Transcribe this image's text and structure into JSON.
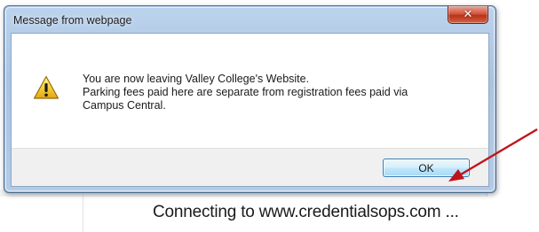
{
  "dialog": {
    "title": "Message from webpage",
    "close_icon": "close-icon",
    "warning_icon": "warning-icon",
    "message_lines": [
      "You are now leaving Valley College's Website.",
      "Parking fees paid here are separate from registration fees paid via",
      "Campus Central."
    ],
    "ok_label": "OK"
  },
  "status": {
    "text": "Connecting to www.credentialsops.com ..."
  },
  "annotation": {
    "icon": "red-arrow-icon",
    "color": "#c0141a"
  }
}
